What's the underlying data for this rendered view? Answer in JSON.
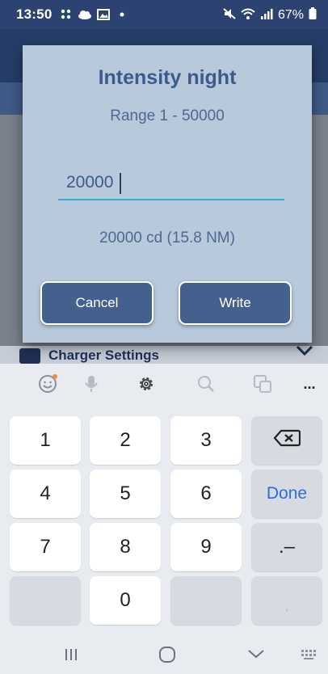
{
  "status_bar": {
    "time": "13:50",
    "battery": "67%"
  },
  "dialog": {
    "title": "Intensity night",
    "range": "Range 1 - 50000",
    "input_value": "20000",
    "conversion": "20000 cd (15.8 NM)",
    "cancel_label": "Cancel",
    "write_label": "Write"
  },
  "background": {
    "section_label": "Charger Settings"
  },
  "keyboard": {
    "keys": [
      "1",
      "2",
      "3",
      "4",
      "5",
      "6",
      "7",
      "8",
      "9",
      "0"
    ],
    "done_label": "Done",
    "minus_label": ".–",
    "comma_label": ",",
    "more_label": "..."
  }
}
